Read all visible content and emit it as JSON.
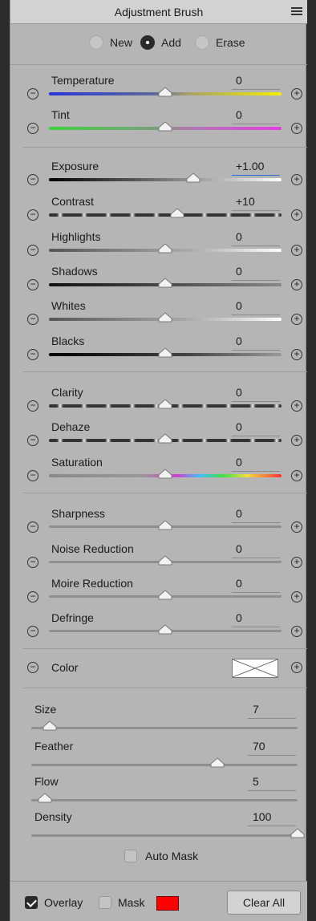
{
  "panel": {
    "title": "Adjustment Brush"
  },
  "mode": {
    "options": [
      "New",
      "Add",
      "Erase"
    ],
    "selected": "Add"
  },
  "sliders": [
    {
      "label": "Temperature",
      "value": "0",
      "position": 0.5,
      "track": "temperature"
    },
    {
      "label": "Tint",
      "value": "0",
      "position": 0.5,
      "track": "tint"
    },
    {
      "label": "Exposure",
      "value": "+1.00",
      "position": 0.62,
      "track": "bw",
      "active": true
    },
    {
      "label": "Contrast",
      "value": "+10",
      "position": 0.55,
      "track": "contrast"
    },
    {
      "label": "Highlights",
      "value": "0",
      "position": 0.5,
      "track": "light"
    },
    {
      "label": "Shadows",
      "value": "0",
      "position": 0.5,
      "track": "dark"
    },
    {
      "label": "Whites",
      "value": "0",
      "position": 0.5,
      "track": "light"
    },
    {
      "label": "Blacks",
      "value": "0",
      "position": 0.5,
      "track": "blackwhite"
    },
    {
      "label": "Clarity",
      "value": "0",
      "position": 0.5,
      "track": "contrast"
    },
    {
      "label": "Dehaze",
      "value": "0",
      "position": 0.5,
      "track": "contrast"
    },
    {
      "label": "Saturation",
      "value": "0",
      "position": 0.5,
      "track": "saturation"
    },
    {
      "label": "Sharpness",
      "value": "0",
      "position": 0.5,
      "track": "flat"
    },
    {
      "label": "Noise Reduction",
      "value": "0",
      "position": 0.5,
      "track": "flat"
    },
    {
      "label": "Moire Reduction",
      "value": "0",
      "position": 0.5,
      "track": "flat"
    },
    {
      "label": "Defringe",
      "value": "0",
      "position": 0.5,
      "track": "flat"
    }
  ],
  "color": {
    "label": "Color"
  },
  "brush": [
    {
      "label": "Size",
      "value": "7",
      "position": 0.07
    },
    {
      "label": "Feather",
      "value": "70",
      "position": 0.7
    },
    {
      "label": "Flow",
      "value": "5",
      "position": 0.05
    },
    {
      "label": "Density",
      "value": "100",
      "position": 1.0
    }
  ],
  "auto_mask": {
    "label": "Auto Mask",
    "checked": false
  },
  "footer": {
    "overlay_label": "Overlay",
    "overlay_checked": true,
    "mask_label": "Mask",
    "mask_checked": false,
    "mask_color": "#ff0000",
    "clear_label": "Clear All"
  },
  "colors": {
    "panel_bg": "#b5b5b5",
    "accent": "#2b6fd6"
  }
}
